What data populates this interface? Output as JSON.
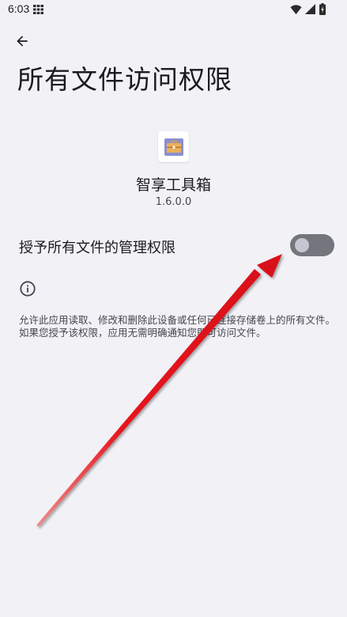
{
  "status_bar": {
    "time": "6:03",
    "icons": [
      "grid-icon",
      "wifi-icon",
      "signal-icon",
      "battery-icon"
    ]
  },
  "header": {
    "back_icon": "arrow-left-icon",
    "title": "所有文件访问权限"
  },
  "app": {
    "icon": "toolbox-icon",
    "name": "智享工具箱",
    "version": "1.6.0.0"
  },
  "permission": {
    "label": "授予所有文件的管理权限",
    "toggle_on": false
  },
  "info": {
    "icon": "info-icon",
    "description": "允许此应用读取、修改和删除此设备或任何已连接存储卷上的所有文件。如果您授予该权限，应用无需明确通知您即可访问文件。"
  },
  "annotation": {
    "type": "arrow",
    "color": "#e8141c",
    "points_to": "toggle-switch"
  },
  "colors": {
    "background": "#f2f1f6",
    "toggle_track": "#74767e",
    "toggle_thumb": "#c4c6d0"
  }
}
